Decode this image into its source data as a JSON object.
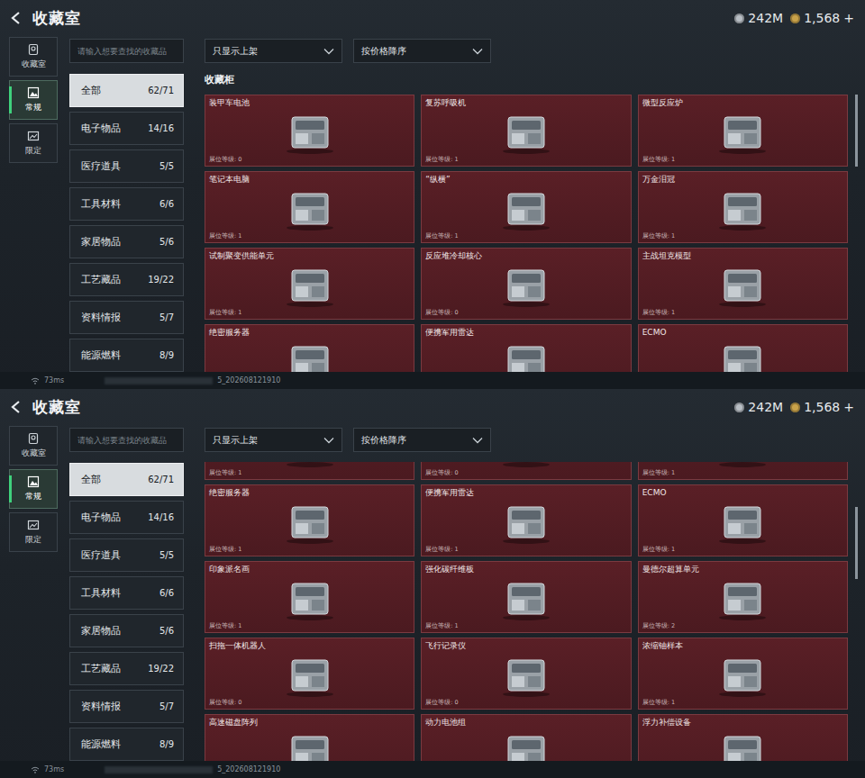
{
  "screens": [
    {
      "header": {
        "title": "收藏室",
        "currencies": [
          {
            "amount": "242M",
            "suffix": "",
            "color": "#b8bec4"
          },
          {
            "amount": "1,568",
            "suffix": "+",
            "color": "#c9a24a"
          }
        ]
      },
      "nav": [
        {
          "label": "收藏室",
          "selected": false
        },
        {
          "label": "常规",
          "selected": true
        },
        {
          "label": "限定",
          "selected": false
        }
      ],
      "search": {
        "placeholder": "请输入想要查找的收藏品"
      },
      "categories": [
        {
          "label": "全部",
          "count": "62/71",
          "selected": true
        },
        {
          "label": "电子物品",
          "count": "14/16",
          "selected": false
        },
        {
          "label": "医疗道具",
          "count": "5/5",
          "selected": false
        },
        {
          "label": "工具材料",
          "count": "6/6",
          "selected": false
        },
        {
          "label": "家居物品",
          "count": "5/6",
          "selected": false
        },
        {
          "label": "工艺藏品",
          "count": "19/22",
          "selected": false
        },
        {
          "label": "资料情报",
          "count": "5/7",
          "selected": false
        },
        {
          "label": "能源燃料",
          "count": "8/9",
          "selected": false
        }
      ],
      "filters": [
        {
          "label": "只显示上架"
        },
        {
          "label": "按价格降序"
        }
      ],
      "section_title": "收藏柜",
      "scroll_level": 0.0,
      "cards": [
        {
          "kind": "full",
          "name": "装甲车电池",
          "level": "展位等级: 0"
        },
        {
          "kind": "full",
          "name": "复苏呼吸机",
          "level": "展位等级: 1"
        },
        {
          "kind": "full",
          "name": "微型反应炉",
          "level": "展位等级: 1"
        },
        {
          "kind": "full",
          "name": "笔记本电脑",
          "level": "展位等级: 1"
        },
        {
          "kind": "full",
          "name": "“纵横”",
          "level": "展位等级: 1"
        },
        {
          "kind": "full",
          "name": "万金泪冠",
          "level": "展位等级: 1"
        },
        {
          "kind": "full",
          "name": "试制聚变供能单元",
          "level": "展位等级: 1"
        },
        {
          "kind": "full",
          "name": "反应堆冷却核心",
          "level": "展位等级: 0"
        },
        {
          "kind": "full",
          "name": "主战坦克模型",
          "level": "展位等级: 1"
        },
        {
          "kind": "full",
          "name": "绝密服务器"
        },
        {
          "kind": "full",
          "name": "便携军用雷达"
        },
        {
          "kind": "full",
          "name": "ECMO"
        }
      ],
      "footer": {
        "ping": "73ms",
        "build": "5_202608121910"
      }
    },
    {
      "header": {
        "title": "收藏室",
        "currencies": [
          {
            "amount": "242M",
            "suffix": "",
            "color": "#b8bec4"
          },
          {
            "amount": "1,568",
            "suffix": "+",
            "color": "#c9a24a"
          }
        ]
      },
      "nav": [
        {
          "label": "收藏室",
          "selected": false
        },
        {
          "label": "常规",
          "selected": true
        },
        {
          "label": "限定",
          "selected": false
        }
      ],
      "search": {
        "placeholder": "请输入想要查找的收藏品"
      },
      "categories": [
        {
          "label": "全部",
          "count": "62/71",
          "selected": true
        },
        {
          "label": "电子物品",
          "count": "14/16",
          "selected": false
        },
        {
          "label": "医疗道具",
          "count": "5/5",
          "selected": false
        },
        {
          "label": "工具材料",
          "count": "6/6",
          "selected": false
        },
        {
          "label": "家居物品",
          "count": "5/6",
          "selected": false
        },
        {
          "label": "工艺藏品",
          "count": "19/22",
          "selected": false
        },
        {
          "label": "资料情报",
          "count": "5/7",
          "selected": false
        },
        {
          "label": "能源燃料",
          "count": "8/9",
          "selected": false
        }
      ],
      "filters": [
        {
          "label": "只显示上架"
        },
        {
          "label": "按价格降序"
        }
      ],
      "scroll_level": 0.2,
      "cards": [
        {
          "kind": "clipped",
          "level": "展位等级: 1"
        },
        {
          "kind": "clipped",
          "level": "展位等级: 0"
        },
        {
          "kind": "clipped",
          "level": "展位等级: 1"
        },
        {
          "kind": "full",
          "name": "绝密服务器",
          "level": "展位等级: 1"
        },
        {
          "kind": "full",
          "name": "便携军用雷达",
          "level": "展位等级: 1"
        },
        {
          "kind": "full",
          "name": "ECMO",
          "level": "展位等级: 1"
        },
        {
          "kind": "full",
          "name": "印象派名画",
          "level": "展位等级: 1"
        },
        {
          "kind": "full",
          "name": "强化碳纤维板",
          "level": "展位等级: 1"
        },
        {
          "kind": "full",
          "name": "曼德尔超算单元",
          "level": "展位等级: 2"
        },
        {
          "kind": "full",
          "name": "扫拖一体机器人",
          "level": "展位等级: 0"
        },
        {
          "kind": "full",
          "name": "飞行记录仪",
          "level": "展位等级: 0"
        },
        {
          "kind": "full",
          "name": "浓缩铀样本",
          "level": "展位等级: 1"
        },
        {
          "kind": "full",
          "name": "高速磁盘阵列"
        },
        {
          "kind": "full",
          "name": "动力电池组"
        },
        {
          "kind": "full",
          "name": "浮力补偿设备"
        }
      ],
      "footer": {
        "ping": "73ms",
        "build": "5_202608121910"
      }
    }
  ]
}
